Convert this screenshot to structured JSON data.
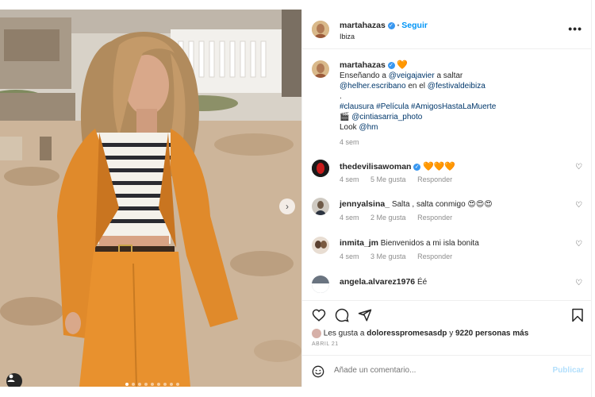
{
  "post": {
    "author": "martahazas",
    "location": "Ibiza",
    "follow_label": "Seguir",
    "more_icon": "more-horizontal-icon"
  },
  "caption": {
    "author": "martahazas",
    "line1_a": "Enseñando a ",
    "mention1": "@veigajavier",
    "line1_b": " a saltar",
    "mention2": "@helher.escribano",
    "line2_b": " en el ",
    "mention3": "@festivaldeibiza",
    "dot": ".",
    "hashtags": "#clausura #Película #AmigosHastaLaMuerte",
    "camera_emoji": "🎬",
    "mention4": "@cintiasarria_photo",
    "look_label": "Look ",
    "mention5": "@hm",
    "time": "4 sem",
    "heart": "🧡"
  },
  "comments": [
    {
      "user": "thedevilisawoman",
      "text": "🧡🧡🧡",
      "time": "4 sem",
      "likes": "5 Me gusta",
      "reply": "Responder"
    },
    {
      "user": "jennyalsina_",
      "text": "Salta , salta conmigo 😍😍😍",
      "time": "4 sem",
      "likes": "2 Me gusta",
      "reply": "Responder"
    },
    {
      "user": "inmita_jm",
      "text": "Bienvenidos a mi isla bonita",
      "time": "4 sem",
      "likes": "3 Me gusta",
      "reply": "Responder"
    },
    {
      "user": "angela.alvarez1976",
      "text": "Éé"
    }
  ],
  "likes": {
    "prefix": "Les gusta a ",
    "user": "doloresspromesasdp",
    "suffix": " y ",
    "count": "9220 personas más"
  },
  "date": "ABRIL 21",
  "comment_box": {
    "placeholder": "Añade un comentario...",
    "publish": "Publicar"
  },
  "colors": {
    "accent": "#0095f6",
    "jacket": "#e08a2b",
    "heart_orange": "#f0630f"
  }
}
